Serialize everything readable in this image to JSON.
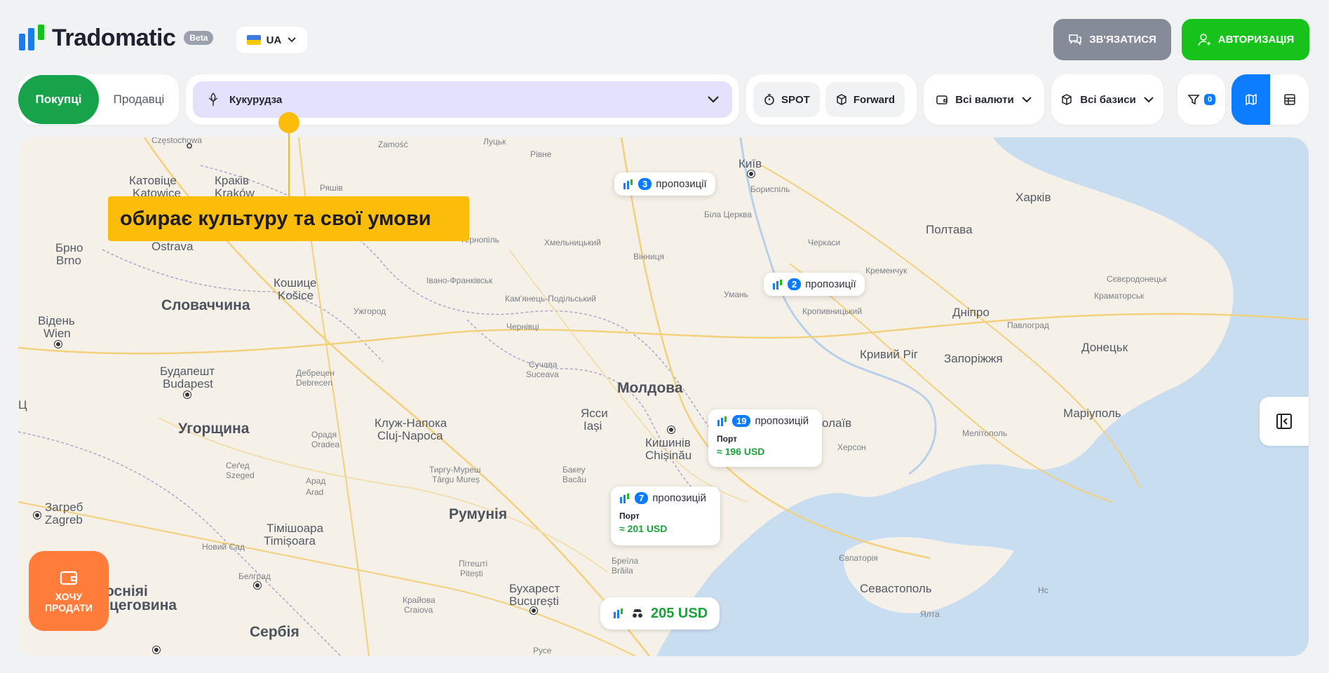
{
  "header": {
    "brand": "Tradomatic",
    "beta": "Beta",
    "lang": "UA",
    "contact_label": "ЗВ'ЯЗАТИСЯ",
    "auth_label": "АВТОРИЗАЦІЯ"
  },
  "filters": {
    "buyers": "Покупці",
    "sellers": "Продавці",
    "crop": "Кукурудза",
    "spot": "SPOT",
    "forward": "Forward",
    "currencies": "Всі валюти",
    "bases": "Всі базиси",
    "filter_count": "0"
  },
  "callout": "обирає культуру та свої умови",
  "offers": [
    {
      "count": "3",
      "label": "пропозиції"
    },
    {
      "count": "2",
      "label": "пропозиції"
    },
    {
      "count": "19",
      "label": "пропозицій",
      "port": "Порт",
      "price": "≈ 196 USD"
    },
    {
      "count": "7",
      "label": "пропозицій",
      "port": "Порт",
      "price": "≈ 201 USD"
    }
  ],
  "price_chip": "205 USD",
  "sell_button": {
    "line1": "ХОЧУ",
    "line2": "ПРОДАТИ"
  },
  "map_labels": {
    "czestochowa": "Częstochowa",
    "zamosc": "Zamość",
    "lutsk": "Луцьк",
    "rivne": "Рівне",
    "kyiv": "Київ",
    "boryspil": "Бориспіль",
    "katowice1": "Катовіце",
    "katowice2": "Katowice",
    "krakow1": "Краків",
    "krakow2": "Kraków",
    "rzeszow": "Ряшів",
    "kharkiv": "Харків",
    "bila": "Біла Церква",
    "poltava": "Полтава",
    "ostrava": "Ostrava",
    "ternopil": "Тернопіль",
    "khmelnytskyi": "Хмельницький",
    "vinnytsia": "Вінниця",
    "cherkasy": "Черкаси",
    "brno1": "Брно",
    "brno2": "Brno",
    "kosice1": "Кошице",
    "kosice2": "Košice",
    "ivano": "Івано-Франківськ",
    "kremenchuk": "Кременчук",
    "sievierodonetsk": "Сєвєродонецьк",
    "slovakia": "Словаччина",
    "kamianets": "Кам'янець-Подільський",
    "uman": "Умань",
    "kropyvnytskyi": "Кропивницький",
    "kramatorsk": "Краматорськ",
    "uzhhorod": "Ужгород",
    "wien1": "Відень",
    "wien2": "Wien",
    "chernivtsi": "Чернівці",
    "dnipro": "Дніпро",
    "pavlohrad": "Павлоград",
    "kryvyi": "Кривий Ріг",
    "donetsk": "Донецьк",
    "zaporizhzhia": "Запоріжжя",
    "suceava1": "Сучава",
    "suceava2": "Suceava",
    "budapest1": "Будапешт",
    "budapest2": "Budapest",
    "debrecen1": "Дебрецен",
    "debrecen2": "Debrecen",
    "moldova": "Молдова",
    "iasi1": "Ясси",
    "iasi2": "Iași",
    "mariupol": "Маріуполь",
    "hungary": "Угорщина",
    "cluj1": "Клуж-Напока",
    "cluj2": "Cluj-Napoca",
    "chisinau1": "Кишинів",
    "chisinau2": "Chișinău",
    "mykolaiv": "олаїв",
    "oradea1": "Орадя",
    "oradea2": "Oradea",
    "kherson": "Херсон",
    "melitopol": "Мелітополь",
    "szeged1": "Сеґед",
    "szeged2": "Szeged",
    "tirgu1": "Тиргу-Муреш",
    "tirgu2": "Târgu Mureș",
    "bacau1": "Бакеу",
    "bacau2": "Bacău",
    "arad1": "Арад",
    "arad2": "Arad",
    "zagreb1": "Загреб",
    "zagreb2": "Zagreb",
    "romania": "Румунія",
    "timisoara1": "Тімішоара",
    "timisoara2": "Timișoara",
    "novisad": "Новий Сад",
    "braila1": "Бреїла",
    "braila2": "Brăila",
    "yevpatoriia": "Євпаторія",
    "pitesti1": "Пітешті",
    "pitesti2": "Pitești",
    "belgrade": "Белград",
    "sevastopol": "Севастополь",
    "bosnia1": "осніяі",
    "bosnia2": "цеговина",
    "bucharest1": "Бухарест",
    "bucharest2": "București",
    "craiova1": "Крайова",
    "craiova2": "Craiova",
    "yalta": "Ялта",
    "serbia": "Сербія",
    "ruse": "Русе",
    "edge_left": "Ц",
    "sea_hint": "Нс"
  },
  "colors": {
    "buy_green": "#16a34a",
    "auth_green": "#17c21a",
    "contact_grey": "#858b99",
    "accent_blue": "#0b7cff",
    "callout_yellow": "#fbbd09",
    "sell_orange": "#ff7c3a",
    "sea_blue": "#c8dcf0",
    "land": "#f5f1e8"
  }
}
